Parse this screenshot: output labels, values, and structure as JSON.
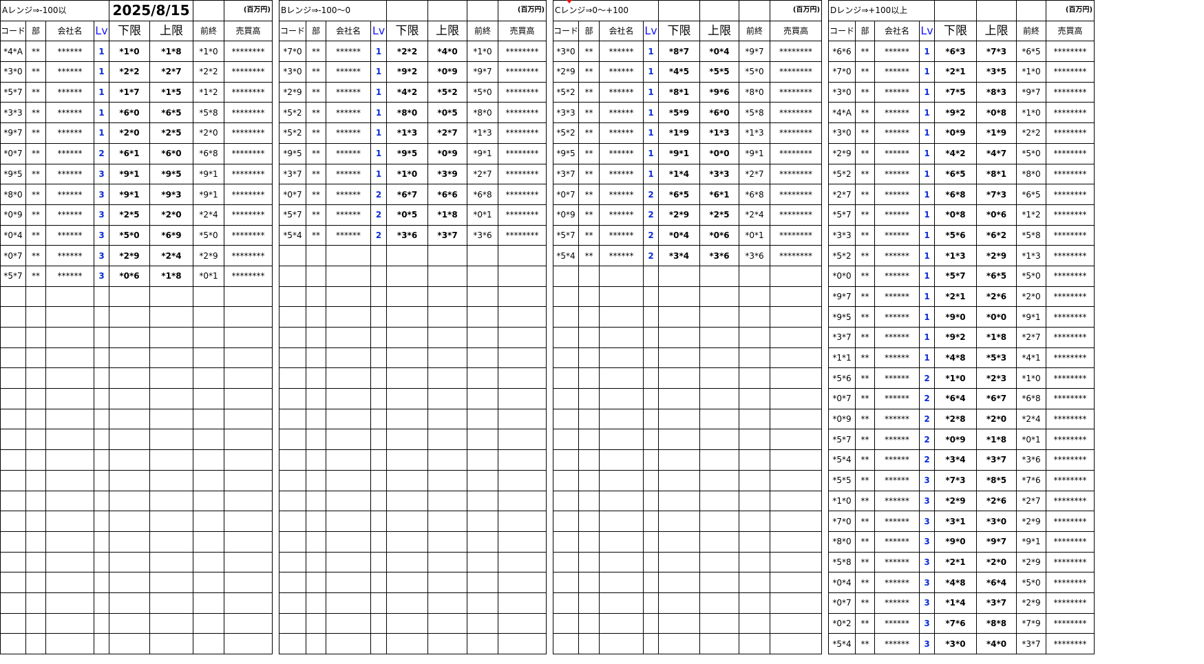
{
  "header": {
    "date": "2025/8/15",
    "unit_note": "(百万円)"
  },
  "columns": {
    "code": "コード",
    "dept": "部",
    "company": "会社名",
    "lv": "Lv",
    "lower": "下限",
    "upper": "上限",
    "prev_close": "前終",
    "turnover": "売買高"
  },
  "ranges": [
    {
      "title": "Aレンジ⇒-100以",
      "rows": [
        {
          "code": "*4*A",
          "bu": "**",
          "name": "******",
          "lv": "1",
          "lower": "*1*0",
          "upper": "*1*8",
          "prev": "*1*0",
          "sales": "********"
        },
        {
          "code": "*3*0",
          "bu": "**",
          "name": "******",
          "lv": "1",
          "lower": "*2*2",
          "upper": "*2*7",
          "prev": "*2*2",
          "sales": "********"
        },
        {
          "code": "*5*7",
          "bu": "**",
          "name": "******",
          "lv": "1",
          "lower": "*1*7",
          "upper": "*1*5",
          "prev": "*1*2",
          "sales": "********"
        },
        {
          "code": "*3*3",
          "bu": "**",
          "name": "******",
          "lv": "1",
          "lower": "*6*0",
          "upper": "*6*5",
          "prev": "*5*8",
          "sales": "********"
        },
        {
          "code": "*9*7",
          "bu": "**",
          "name": "******",
          "lv": "1",
          "lower": "*2*0",
          "upper": "*2*5",
          "prev": "*2*0",
          "sales": "********"
        },
        {
          "code": "*0*7",
          "bu": "**",
          "name": "******",
          "lv": "2",
          "lower": "*6*1",
          "upper": "*6*0",
          "prev": "*6*8",
          "sales": "********"
        },
        {
          "code": "*9*5",
          "bu": "**",
          "name": "******",
          "lv": "3",
          "lower": "*9*1",
          "upper": "*9*5",
          "prev": "*9*1",
          "sales": "********"
        },
        {
          "code": "*8*0",
          "bu": "**",
          "name": "******",
          "lv": "3",
          "lower": "*9*1",
          "upper": "*9*3",
          "prev": "*9*1",
          "sales": "********"
        },
        {
          "code": "*0*9",
          "bu": "**",
          "name": "******",
          "lv": "3",
          "lower": "*2*5",
          "upper": "*2*0",
          "prev": "*2*4",
          "sales": "********"
        },
        {
          "code": "*0*4",
          "bu": "**",
          "name": "******",
          "lv": "3",
          "lower": "*5*0",
          "upper": "*6*9",
          "prev": "*5*0",
          "sales": "********"
        },
        {
          "code": "*0*7",
          "bu": "**",
          "name": "******",
          "lv": "3",
          "lower": "*2*9",
          "upper": "*2*4",
          "prev": "*2*9",
          "sales": "********"
        },
        {
          "code": "*5*7",
          "bu": "**",
          "name": "******",
          "lv": "3",
          "lower": "*0*6",
          "upper": "*1*8",
          "prev": "*0*1",
          "sales": "********"
        }
      ]
    },
    {
      "title": "Bレンジ⇒-100～0",
      "rows": [
        {
          "code": "*7*0",
          "bu": "**",
          "name": "******",
          "lv": "1",
          "lower": "*2*2",
          "upper": "*4*0",
          "prev": "*1*0",
          "sales": "********"
        },
        {
          "code": "*3*0",
          "bu": "**",
          "name": "******",
          "lv": "1",
          "lower": "*9*2",
          "upper": "*0*9",
          "prev": "*9*7",
          "sales": "********"
        },
        {
          "code": "*2*9",
          "bu": "**",
          "name": "******",
          "lv": "1",
          "lower": "*4*2",
          "upper": "*5*2",
          "prev": "*5*0",
          "sales": "********"
        },
        {
          "code": "*5*2",
          "bu": "**",
          "name": "******",
          "lv": "1",
          "lower": "*8*0",
          "upper": "*0*5",
          "prev": "*8*0",
          "sales": "********"
        },
        {
          "code": "*5*2",
          "bu": "**",
          "name": "******",
          "lv": "1",
          "lower": "*1*3",
          "upper": "*2*7",
          "prev": "*1*3",
          "sales": "********"
        },
        {
          "code": "*9*5",
          "bu": "**",
          "name": "******",
          "lv": "1",
          "lower": "*9*5",
          "upper": "*0*9",
          "prev": "*9*1",
          "sales": "********"
        },
        {
          "code": "*3*7",
          "bu": "**",
          "name": "******",
          "lv": "1",
          "lower": "*1*0",
          "upper": "*3*9",
          "prev": "*2*7",
          "sales": "********"
        },
        {
          "code": "*0*7",
          "bu": "**",
          "name": "******",
          "lv": "2",
          "lower": "*6*7",
          "upper": "*6*6",
          "prev": "*6*8",
          "sales": "********"
        },
        {
          "code": "*5*7",
          "bu": "**",
          "name": "******",
          "lv": "2",
          "lower": "*0*5",
          "upper": "*1*8",
          "prev": "*0*1",
          "sales": "********"
        },
        {
          "code": "*5*4",
          "bu": "**",
          "name": "******",
          "lv": "2",
          "lower": "*3*6",
          "upper": "*3*7",
          "prev": "*3*6",
          "sales": "********"
        }
      ]
    },
    {
      "title": "Cレンジ⇒0～+100",
      "rows": [
        {
          "code": "*3*0",
          "bu": "**",
          "name": "******",
          "lv": "1",
          "lower": "*8*7",
          "upper": "*0*4",
          "prev": "*9*7",
          "sales": "********"
        },
        {
          "code": "*2*9",
          "bu": "**",
          "name": "******",
          "lv": "1",
          "lower": "*4*5",
          "upper": "*5*5",
          "prev": "*5*0",
          "sales": "********"
        },
        {
          "code": "*5*2",
          "bu": "**",
          "name": "******",
          "lv": "1",
          "lower": "*8*1",
          "upper": "*9*6",
          "prev": "*8*0",
          "sales": "********"
        },
        {
          "code": "*3*3",
          "bu": "**",
          "name": "******",
          "lv": "1",
          "lower": "*5*9",
          "upper": "*6*0",
          "prev": "*5*8",
          "sales": "********"
        },
        {
          "code": "*5*2",
          "bu": "**",
          "name": "******",
          "lv": "1",
          "lower": "*1*9",
          "upper": "*1*3",
          "prev": "*1*3",
          "sales": "********"
        },
        {
          "code": "*9*5",
          "bu": "**",
          "name": "******",
          "lv": "1",
          "lower": "*9*1",
          "upper": "*0*0",
          "prev": "*9*1",
          "sales": "********"
        },
        {
          "code": "*3*7",
          "bu": "**",
          "name": "******",
          "lv": "1",
          "lower": "*1*4",
          "upper": "*3*3",
          "prev": "*2*7",
          "sales": "********"
        },
        {
          "code": "*0*7",
          "bu": "**",
          "name": "******",
          "lv": "2",
          "lower": "*6*5",
          "upper": "*6*1",
          "prev": "*6*8",
          "sales": "********"
        },
        {
          "code": "*0*9",
          "bu": "**",
          "name": "******",
          "lv": "2",
          "lower": "*2*9",
          "upper": "*2*5",
          "prev": "*2*4",
          "sales": "********"
        },
        {
          "code": "*5*7",
          "bu": "**",
          "name": "******",
          "lv": "2",
          "lower": "*0*4",
          "upper": "*0*6",
          "prev": "*0*1",
          "sales": "********"
        },
        {
          "code": "*5*4",
          "bu": "**",
          "name": "******",
          "lv": "2",
          "lower": "*3*4",
          "upper": "*3*6",
          "prev": "*3*6",
          "sales": "********"
        }
      ]
    },
    {
      "title": "Dレンジ⇒+100以上",
      "rows": [
        {
          "code": "*6*6",
          "bu": "**",
          "name": "******",
          "lv": "1",
          "lower": "*6*3",
          "upper": "*7*3",
          "prev": "*6*5",
          "sales": "********"
        },
        {
          "code": "*7*0",
          "bu": "**",
          "name": "******",
          "lv": "1",
          "lower": "*2*1",
          "upper": "*3*5",
          "prev": "*1*0",
          "sales": "********"
        },
        {
          "code": "*3*0",
          "bu": "**",
          "name": "******",
          "lv": "1",
          "lower": "*7*5",
          "upper": "*8*3",
          "prev": "*9*7",
          "sales": "********"
        },
        {
          "code": "*4*A",
          "bu": "**",
          "name": "******",
          "lv": "1",
          "lower": "*9*2",
          "upper": "*0*8",
          "prev": "*1*0",
          "sales": "********"
        },
        {
          "code": "*3*0",
          "bu": "**",
          "name": "******",
          "lv": "1",
          "lower": "*0*9",
          "upper": "*1*9",
          "prev": "*2*2",
          "sales": "********"
        },
        {
          "code": "*2*9",
          "bu": "**",
          "name": "******",
          "lv": "1",
          "lower": "*4*2",
          "upper": "*4*7",
          "prev": "*5*0",
          "sales": "********"
        },
        {
          "code": "*5*2",
          "bu": "**",
          "name": "******",
          "lv": "1",
          "lower": "*6*5",
          "upper": "*8*1",
          "prev": "*8*0",
          "sales": "********"
        },
        {
          "code": "*2*7",
          "bu": "**",
          "name": "******",
          "lv": "1",
          "lower": "*6*8",
          "upper": "*7*3",
          "prev": "*6*5",
          "sales": "********"
        },
        {
          "code": "*5*7",
          "bu": "**",
          "name": "******",
          "lv": "1",
          "lower": "*0*8",
          "upper": "*0*6",
          "prev": "*1*2",
          "sales": "********"
        },
        {
          "code": "*3*3",
          "bu": "**",
          "name": "******",
          "lv": "1",
          "lower": "*5*6",
          "upper": "*6*2",
          "prev": "*5*8",
          "sales": "********"
        },
        {
          "code": "*5*2",
          "bu": "**",
          "name": "******",
          "lv": "1",
          "lower": "*1*3",
          "upper": "*2*9",
          "prev": "*1*3",
          "sales": "********"
        },
        {
          "code": "*0*0",
          "bu": "**",
          "name": "******",
          "lv": "1",
          "lower": "*5*7",
          "upper": "*6*5",
          "prev": "*5*0",
          "sales": "********"
        },
        {
          "code": "*9*7",
          "bu": "**",
          "name": "******",
          "lv": "1",
          "lower": "*2*1",
          "upper": "*2*6",
          "prev": "*2*0",
          "sales": "********"
        },
        {
          "code": "*9*5",
          "bu": "**",
          "name": "******",
          "lv": "1",
          "lower": "*9*0",
          "upper": "*0*0",
          "prev": "*9*1",
          "sales": "********"
        },
        {
          "code": "*3*7",
          "bu": "**",
          "name": "******",
          "lv": "1",
          "lower": "*9*2",
          "upper": "*1*8",
          "prev": "*2*7",
          "sales": "********"
        },
        {
          "code": "*1*1",
          "bu": "**",
          "name": "******",
          "lv": "1",
          "lower": "*4*8",
          "upper": "*5*3",
          "prev": "*4*1",
          "sales": "********"
        },
        {
          "code": "*5*6",
          "bu": "**",
          "name": "******",
          "lv": "2",
          "lower": "*1*0",
          "upper": "*2*3",
          "prev": "*1*0",
          "sales": "********"
        },
        {
          "code": "*0*7",
          "bu": "**",
          "name": "******",
          "lv": "2",
          "lower": "*6*4",
          "upper": "*6*7",
          "prev": "*6*8",
          "sales": "********"
        },
        {
          "code": "*0*9",
          "bu": "**",
          "name": "******",
          "lv": "2",
          "lower": "*2*8",
          "upper": "*2*0",
          "prev": "*2*4",
          "sales": "********"
        },
        {
          "code": "*5*7",
          "bu": "**",
          "name": "******",
          "lv": "2",
          "lower": "*0*9",
          "upper": "*1*8",
          "prev": "*0*1",
          "sales": "********"
        },
        {
          "code": "*5*4",
          "bu": "**",
          "name": "******",
          "lv": "2",
          "lower": "*3*4",
          "upper": "*3*7",
          "prev": "*3*6",
          "sales": "********"
        },
        {
          "code": "*5*5",
          "bu": "**",
          "name": "******",
          "lv": "3",
          "lower": "*7*3",
          "upper": "*8*5",
          "prev": "*7*6",
          "sales": "********"
        },
        {
          "code": "*1*0",
          "bu": "**",
          "name": "******",
          "lv": "3",
          "lower": "*2*9",
          "upper": "*2*6",
          "prev": "*2*7",
          "sales": "********"
        },
        {
          "code": "*7*0",
          "bu": "**",
          "name": "******",
          "lv": "3",
          "lower": "*3*1",
          "upper": "*3*0",
          "prev": "*2*9",
          "sales": "********"
        },
        {
          "code": "*8*0",
          "bu": "**",
          "name": "******",
          "lv": "3",
          "lower": "*9*0",
          "upper": "*9*7",
          "prev": "*9*1",
          "sales": "********"
        },
        {
          "code": "*5*8",
          "bu": "**",
          "name": "******",
          "lv": "3",
          "lower": "*2*1",
          "upper": "*2*0",
          "prev": "*2*9",
          "sales": "********"
        },
        {
          "code": "*0*4",
          "bu": "**",
          "name": "******",
          "lv": "3",
          "lower": "*4*8",
          "upper": "*6*4",
          "prev": "*5*0",
          "sales": "********"
        },
        {
          "code": "*0*7",
          "bu": "**",
          "name": "******",
          "lv": "3",
          "lower": "*1*4",
          "upper": "*3*7",
          "prev": "*2*9",
          "sales": "********"
        },
        {
          "code": "*0*2",
          "bu": "**",
          "name": "******",
          "lv": "3",
          "lower": "*7*6",
          "upper": "*8*8",
          "prev": "*7*9",
          "sales": "********"
        },
        {
          "code": "*5*4",
          "bu": "**",
          "name": "******",
          "lv": "3",
          "lower": "*3*0",
          "upper": "*4*0",
          "prev": "*3*7",
          "sales": "********"
        }
      ]
    }
  ]
}
